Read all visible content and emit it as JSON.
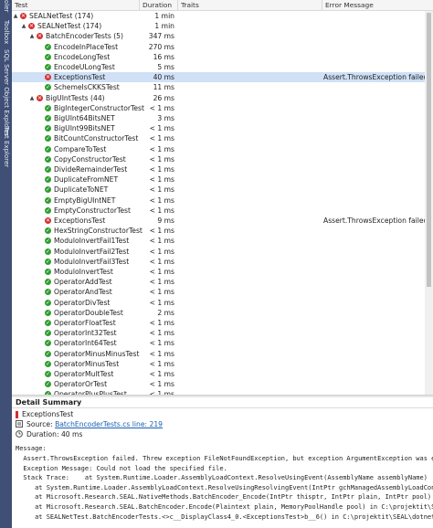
{
  "side_tabs": [
    "oler",
    "Toolbox",
    "SQL Server Object Explorer",
    "Test Explorer"
  ],
  "columns": {
    "test": "Test",
    "duration": "Duration",
    "traits": "Traits",
    "error": "Error Message"
  },
  "rows": [
    {
      "indent": 0,
      "expander": "▲",
      "status": "fail",
      "name": "SEALNetTest (174)",
      "duration": "1 min",
      "error": ""
    },
    {
      "indent": 1,
      "expander": "▲",
      "status": "fail",
      "name": "SEALNetTest (174)",
      "duration": "1 min",
      "error": ""
    },
    {
      "indent": 2,
      "expander": "▲",
      "status": "fail",
      "name": "BatchEncoderTests (5)",
      "duration": "347 ms",
      "error": ""
    },
    {
      "indent": 3,
      "expander": "",
      "status": "pass",
      "name": "EncodeInPlaceTest",
      "duration": "270 ms",
      "error": ""
    },
    {
      "indent": 3,
      "expander": "",
      "status": "pass",
      "name": "EncodeLongTest",
      "duration": "16 ms",
      "error": ""
    },
    {
      "indent": 3,
      "expander": "",
      "status": "pass",
      "name": "EncodeULongTest",
      "duration": "5 ms",
      "error": ""
    },
    {
      "indent": 3,
      "expander": "",
      "status": "fail",
      "name": "ExceptionsTest",
      "duration": "40 ms",
      "error": "Assert.ThrowsException failed. Th...",
      "selected": true
    },
    {
      "indent": 3,
      "expander": "",
      "status": "pass",
      "name": "SchemeIsCKKSTest",
      "duration": "11 ms",
      "error": ""
    },
    {
      "indent": 2,
      "expander": "▲",
      "status": "fail",
      "name": "BigUIntTests (44)",
      "duration": "26 ms",
      "error": ""
    },
    {
      "indent": 3,
      "expander": "",
      "status": "pass",
      "name": "BigIntegerConstructorTest",
      "duration": "< 1 ms",
      "error": ""
    },
    {
      "indent": 3,
      "expander": "",
      "status": "pass",
      "name": "BigUInt64BitsNET",
      "duration": "3 ms",
      "error": ""
    },
    {
      "indent": 3,
      "expander": "",
      "status": "pass",
      "name": "BigUInt99BitsNET",
      "duration": "< 1 ms",
      "error": ""
    },
    {
      "indent": 3,
      "expander": "",
      "status": "pass",
      "name": "BitCountConstructorTest",
      "duration": "< 1 ms",
      "error": ""
    },
    {
      "indent": 3,
      "expander": "",
      "status": "pass",
      "name": "CompareToTest",
      "duration": "< 1 ms",
      "error": ""
    },
    {
      "indent": 3,
      "expander": "",
      "status": "pass",
      "name": "CopyConstructorTest",
      "duration": "< 1 ms",
      "error": ""
    },
    {
      "indent": 3,
      "expander": "",
      "status": "pass",
      "name": "DivideRemainderTest",
      "duration": "< 1 ms",
      "error": ""
    },
    {
      "indent": 3,
      "expander": "",
      "status": "pass",
      "name": "DuplicateFromNET",
      "duration": "< 1 ms",
      "error": ""
    },
    {
      "indent": 3,
      "expander": "",
      "status": "pass",
      "name": "DuplicateToNET",
      "duration": "< 1 ms",
      "error": ""
    },
    {
      "indent": 3,
      "expander": "",
      "status": "pass",
      "name": "EmptyBigUIntNET",
      "duration": "< 1 ms",
      "error": ""
    },
    {
      "indent": 3,
      "expander": "",
      "status": "pass",
      "name": "EmptyConstructorTest",
      "duration": "< 1 ms",
      "error": ""
    },
    {
      "indent": 3,
      "expander": "",
      "status": "fail",
      "name": "ExceptionsTest",
      "duration": "9 ms",
      "error": "Assert.ThrowsException failed. Th..."
    },
    {
      "indent": 3,
      "expander": "",
      "status": "pass",
      "name": "HexStringConstructorTest",
      "duration": "< 1 ms",
      "error": ""
    },
    {
      "indent": 3,
      "expander": "",
      "status": "pass",
      "name": "ModuloInvertFail1Test",
      "duration": "< 1 ms",
      "error": ""
    },
    {
      "indent": 3,
      "expander": "",
      "status": "pass",
      "name": "ModuloInvertFail2Test",
      "duration": "< 1 ms",
      "error": ""
    },
    {
      "indent": 3,
      "expander": "",
      "status": "pass",
      "name": "ModuloInvertFail3Test",
      "duration": "< 1 ms",
      "error": ""
    },
    {
      "indent": 3,
      "expander": "",
      "status": "pass",
      "name": "ModuloInvertTest",
      "duration": "< 1 ms",
      "error": ""
    },
    {
      "indent": 3,
      "expander": "",
      "status": "pass",
      "name": "OperatorAddTest",
      "duration": "< 1 ms",
      "error": ""
    },
    {
      "indent": 3,
      "expander": "",
      "status": "pass",
      "name": "OperatorAndTest",
      "duration": "< 1 ms",
      "error": ""
    },
    {
      "indent": 3,
      "expander": "",
      "status": "pass",
      "name": "OperatorDivTest",
      "duration": "< 1 ms",
      "error": ""
    },
    {
      "indent": 3,
      "expander": "",
      "status": "pass",
      "name": "OperatorDoubleTest",
      "duration": "2 ms",
      "error": ""
    },
    {
      "indent": 3,
      "expander": "",
      "status": "pass",
      "name": "OperatorFloatTest",
      "duration": "< 1 ms",
      "error": ""
    },
    {
      "indent": 3,
      "expander": "",
      "status": "pass",
      "name": "OperatorInt32Test",
      "duration": "< 1 ms",
      "error": ""
    },
    {
      "indent": 3,
      "expander": "",
      "status": "pass",
      "name": "OperatorInt64Test",
      "duration": "< 1 ms",
      "error": ""
    },
    {
      "indent": 3,
      "expander": "",
      "status": "pass",
      "name": "OperatorMinusMinusTest",
      "duration": "< 1 ms",
      "error": ""
    },
    {
      "indent": 3,
      "expander": "",
      "status": "pass",
      "name": "OperatorMinusTest",
      "duration": "< 1 ms",
      "error": ""
    },
    {
      "indent": 3,
      "expander": "",
      "status": "pass",
      "name": "OperatorMultTest",
      "duration": "< 1 ms",
      "error": ""
    },
    {
      "indent": 3,
      "expander": "",
      "status": "pass",
      "name": "OperatorOrTest",
      "duration": "< 1 ms",
      "error": ""
    },
    {
      "indent": 3,
      "expander": "",
      "status": "pass",
      "name": "OperatorPlusPlusTest",
      "duration": "< 1 ms",
      "error": ""
    }
  ],
  "detail": {
    "title": "Detail Summary",
    "test_name": "ExceptionsTest",
    "source_label": "Source:",
    "source_link": "BatchEncoderTests.cs line: 219",
    "duration_label": "Duration:",
    "duration_value": "40 ms",
    "message_label": "Message:",
    "lines": [
      "  Assert.ThrowsException failed. Threw exception FileNotFoundException, but exception ArgumentException was expe",
      "  Exception Message: Could not load the specified file.",
      "  Stack Trace:    at System.Runtime.Loader.AssemblyLoadContext.ResolveUsingEvent(AssemblyName assemblyName)",
      "     at System.Runtime.Loader.AssemblyLoadContext.ResolveUsingResolvingEvent(IntPtr gchManagedAssemblyLoadContext",
      "     at Microsoft.Research.SEAL.NativeMethods.BatchEncoder_Encode(IntPtr thisptr, IntPtr plain, IntPtr pool)",
      "     at Microsoft.Research.SEAL.BatchEncoder.Encode(Plaintext plain, MemoryPoolHandle pool) in C:\\projektit\\SEAL",
      "     at SEALNetTest.BatchEncoderTests.<>c__DisplayClass4_0.<ExceptionsTest>b__6() in C:\\projektit\\SEAL\\dotnet\\te"
    ]
  },
  "colors": {
    "pass": "#2f9e2f",
    "fail": "#d32f2f",
    "selected": "#cfe0f7",
    "sidestrip": "#3f4f75",
    "link": "#1a5fb4"
  }
}
